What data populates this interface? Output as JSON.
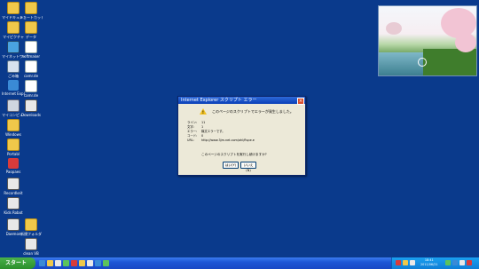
{
  "desktop": {
    "icons": [
      {
        "label": "マイドキュメント",
        "icon": "my-documents-icon",
        "color": "#f0c84a"
      },
      {
        "label": "マイピクチャ",
        "icon": "folder-icon",
        "color": "#f0c84a"
      },
      {
        "label": "マイネットワーク",
        "icon": "network-icon",
        "color": "#4aa3e0"
      },
      {
        "label": "ごみ箱",
        "icon": "recycle-bin-icon",
        "color": "#d8e2ee"
      },
      {
        "label": "Internet Explorer",
        "icon": "ie-icon",
        "color": "#3a8ad6"
      },
      {
        "label": "マイコンピュータ",
        "icon": "my-computer-icon",
        "color": "#cfd6e0"
      },
      {
        "label": "Windows",
        "icon": "folder-icon",
        "color": "#f0c84a"
      },
      {
        "label": "Portabl",
        "icon": "folder-icon",
        "color": "#f0c84a"
      },
      {
        "label": "Paopaes",
        "icon": "app-icon",
        "color": "#d83b3b"
      },
      {
        "label": "Recordkeit",
        "icon": "app-icon",
        "color": "#e8e8e8"
      },
      {
        "label": "Kids Robot",
        "icon": "app-icon",
        "color": "#e8e8e8"
      },
      {
        "label": "Daemon",
        "icon": "app-icon",
        "color": "#e8e8e8"
      },
      {
        "label": "ショートカット",
        "icon": "folder-icon",
        "color": "#f0c84a"
      },
      {
        "label": "データ",
        "icon": "folder-icon",
        "color": "#f0c84a"
      },
      {
        "label": "softmaker",
        "icon": "doc-icon",
        "color": "#ffffff"
      },
      {
        "label": "camr.de",
        "icon": "doc-icon",
        "color": "#ffffff"
      },
      {
        "label": "camr.de",
        "icon": "doc-icon",
        "color": "#ffffff"
      },
      {
        "label": "Downloads",
        "icon": "app-icon",
        "color": "#e8e8e8"
      },
      {
        "label": "新規フォルダ",
        "icon": "folder-icon",
        "color": "#f0c84a"
      },
      {
        "label": "clean VB",
        "icon": "app-icon",
        "color": "#e8e8e8"
      }
    ]
  },
  "dialog": {
    "title": "Internet Explorer スクリプト エラー",
    "close": "×",
    "warning_mark": "!",
    "headline": "このページのスクリプトでエラーが発生しました。",
    "fields": [
      {
        "key": "ライン:",
        "value": "11"
      },
      {
        "key": "文字:",
        "value": "1"
      },
      {
        "key": "エラー:",
        "value": "構文エラーです。"
      },
      {
        "key": "コード:",
        "value": "0"
      },
      {
        "key": "URL:",
        "value": "http://www.3jm.net.com/ahl/flvpe.e"
      }
    ],
    "prompt": "このページのスクリプトを実行し続けますか?",
    "yes": "はい(Y)",
    "no": "いいえ(N)"
  },
  "taskbar": {
    "start": "スタート",
    "tray_clock_line1": "18:41",
    "tray_clock_line2": "2011/06/21"
  },
  "colors": {
    "desktop": "#0a3a8c",
    "taskbar": "#1d56d6",
    "start": "#2b8f2b"
  }
}
